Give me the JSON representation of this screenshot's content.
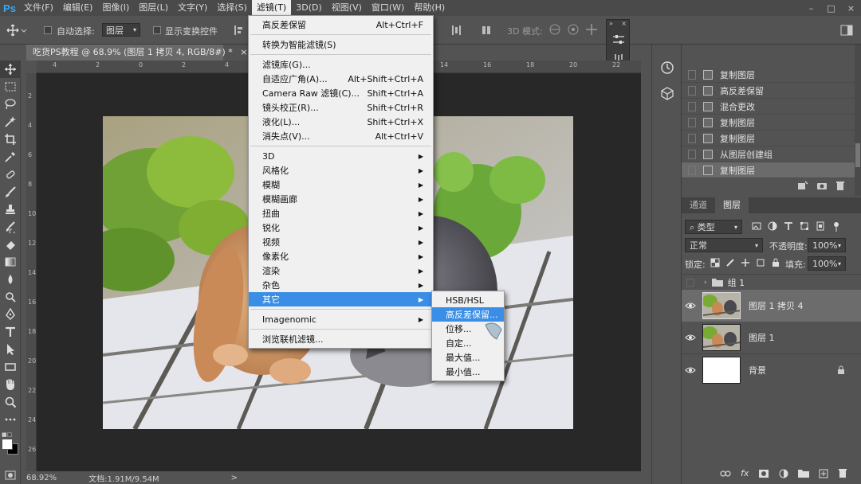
{
  "app": {
    "logo": "Ps",
    "menus": [
      "文件(F)",
      "编辑(E)",
      "图像(I)",
      "图层(L)",
      "文字(Y)",
      "选择(S)",
      "滤镜(T)",
      "3D(D)",
      "视图(V)",
      "窗口(W)",
      "帮助(H)"
    ],
    "active_menu": "滤镜(T)",
    "window_controls": [
      "–",
      "□",
      "×"
    ]
  },
  "options_bar": {
    "auto_select_label": "自动选择:",
    "auto_select_value": "图层",
    "show_transform_label": "显示变换控件",
    "mode_3d_label": "3D 模式:"
  },
  "document": {
    "tab_title": "吃货PS教程 @ 68.9% (图层 1 拷贝 4, RGB/8#) *",
    "tab_close": "×",
    "ruler_h_labels": [
      "4",
      "2",
      "0",
      "2",
      "4",
      "6",
      "8",
      "10",
      "12",
      "14",
      "16",
      "18",
      "20",
      "22"
    ],
    "ruler_v_labels": [
      "2",
      "4",
      "6",
      "8",
      "10",
      "12",
      "14",
      "16",
      "18",
      "20",
      "22",
      "24",
      "26"
    ],
    "status_zoom": "68.92%",
    "status_doc": "文档:1.91M/9.54M",
    "status_arrow": ">"
  },
  "filter_menu": {
    "items": [
      {
        "label": "高反差保留",
        "shortcut": "Alt+Ctrl+F"
      },
      {
        "sep": true
      },
      {
        "label": "转换为智能滤镜(S)"
      },
      {
        "sep": true
      },
      {
        "label": "滤镜库(G)..."
      },
      {
        "label": "自适应广角(A)...",
        "shortcut": "Alt+Shift+Ctrl+A"
      },
      {
        "label": "Camera Raw 滤镜(C)...",
        "shortcut": "Shift+Ctrl+A"
      },
      {
        "label": "镜头校正(R)...",
        "shortcut": "Shift+Ctrl+R"
      },
      {
        "label": "液化(L)...",
        "shortcut": "Shift+Ctrl+X"
      },
      {
        "label": "消失点(V)...",
        "shortcut": "Alt+Ctrl+V"
      },
      {
        "sep": true
      },
      {
        "label": "3D",
        "submenu": true
      },
      {
        "label": "风格化",
        "submenu": true
      },
      {
        "label": "模糊",
        "submenu": true
      },
      {
        "label": "模糊画廊",
        "submenu": true
      },
      {
        "label": "扭曲",
        "submenu": true
      },
      {
        "label": "锐化",
        "submenu": true
      },
      {
        "label": "视频",
        "submenu": true
      },
      {
        "label": "像素化",
        "submenu": true
      },
      {
        "label": "渲染",
        "submenu": true
      },
      {
        "label": "杂色",
        "submenu": true
      },
      {
        "label": "其它",
        "submenu": true,
        "highlighted": true
      },
      {
        "sep": true
      },
      {
        "label": "Imagenomic",
        "submenu": true
      },
      {
        "sep": true
      },
      {
        "label": "浏览联机滤镜..."
      }
    ]
  },
  "other_submenu": {
    "items": [
      {
        "label": "HSB/HSL"
      },
      {
        "label": "高反差保留...",
        "highlighted": true
      },
      {
        "label": "位移..."
      },
      {
        "label": "自定..."
      },
      {
        "label": "最大值..."
      },
      {
        "label": "最小值..."
      }
    ]
  },
  "history": {
    "items": [
      "复制图层",
      "高反差保留",
      "混合更改",
      "复制图层",
      "复制图层",
      "从图层创建组",
      "复制图层"
    ],
    "selected_index": 6
  },
  "layers_panel": {
    "tabs": [
      "通道",
      "图层"
    ],
    "active_tab": "图层",
    "filter_label": "类型",
    "blend_mode": "正常",
    "opacity_label": "不透明度:",
    "opacity_value": "100%",
    "lock_label": "锁定:",
    "fill_label": "填充:",
    "fill_value": "100%",
    "layers": [
      {
        "name": "组 1",
        "type": "group",
        "visible": false
      },
      {
        "name": "图层 1 拷贝 4",
        "type": "image",
        "visible": true,
        "selected": true
      },
      {
        "name": "图层 1",
        "type": "image",
        "visible": true
      },
      {
        "name": "背景",
        "type": "white",
        "visible": true,
        "locked": true
      }
    ],
    "footer_icons": [
      "link-icon",
      "fx-icon",
      "mask-icon",
      "adjustment-icon",
      "folder-icon",
      "new-layer-icon",
      "trash-icon"
    ],
    "footer_fx": "fx"
  },
  "colors": {
    "menu_highlight": "#3a8ee6",
    "ps_blue": "#31a8ff"
  }
}
